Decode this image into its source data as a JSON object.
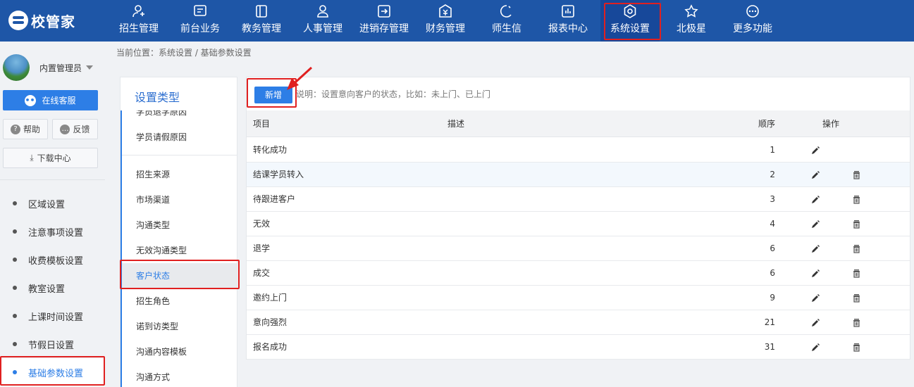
{
  "logo": {
    "text": "校管家"
  },
  "nav": [
    {
      "label": "招生管理",
      "icon": "user-plus-icon"
    },
    {
      "label": "前台业务",
      "icon": "monitor-icon"
    },
    {
      "label": "教务管理",
      "icon": "book-icon"
    },
    {
      "label": "人事管理",
      "icon": "person-icon"
    },
    {
      "label": "进销存管理",
      "icon": "inventory-icon"
    },
    {
      "label": "财务管理",
      "icon": "finance-icon"
    },
    {
      "label": "师生信",
      "icon": "chat-icon"
    },
    {
      "label": "报表中心",
      "icon": "report-icon"
    },
    {
      "label": "系统设置",
      "icon": "settings-icon"
    },
    {
      "label": "北极星",
      "icon": "star-icon"
    },
    {
      "label": "更多功能",
      "icon": "more-icon"
    }
  ],
  "user": {
    "name": "内置管理员"
  },
  "sidebar": {
    "service_label": "在线客服",
    "help_label": "帮助",
    "feedback_label": "反馈",
    "download_label": "下载中心",
    "items": [
      {
        "label": "区域设置"
      },
      {
        "label": "注意事项设置"
      },
      {
        "label": "收费模板设置"
      },
      {
        "label": "教室设置"
      },
      {
        "label": "上课时间设置"
      },
      {
        "label": "节假日设置"
      },
      {
        "label": "基础参数设置"
      }
    ]
  },
  "breadcrumb": "当前位置：系统设置 / 基础参数设置",
  "type_panel": {
    "title": "设置类型",
    "items": [
      {
        "label": "学员退学原因"
      },
      {
        "label": "学员请假原因"
      },
      {
        "label": "招生来源"
      },
      {
        "label": "市场渠道"
      },
      {
        "label": "沟通类型"
      },
      {
        "label": "无效沟通类型"
      },
      {
        "label": "客户状态"
      },
      {
        "label": "招生角色"
      },
      {
        "label": "诺到访类型"
      },
      {
        "label": "沟通内容模板"
      },
      {
        "label": "沟通方式"
      }
    ]
  },
  "main": {
    "add_label": "新增",
    "note": "说明：设置意向客户的状态，比如：未上门、已上门",
    "columns": {
      "item": "项目",
      "desc": "描述",
      "order": "顺序",
      "action": "操作"
    },
    "rows": [
      {
        "item": "转化成功",
        "desc": "",
        "order": "1"
      },
      {
        "item": "结课学员转入",
        "desc": "",
        "order": "2"
      },
      {
        "item": "待跟进客户",
        "desc": "",
        "order": "3"
      },
      {
        "item": "无效",
        "desc": "",
        "order": "4"
      },
      {
        "item": "退学",
        "desc": "",
        "order": "6"
      },
      {
        "item": "成交",
        "desc": "",
        "order": "6"
      },
      {
        "item": "邀约上门",
        "desc": "",
        "order": "9"
      },
      {
        "item": "意向强烈",
        "desc": "",
        "order": "21"
      },
      {
        "item": "报名成功",
        "desc": "",
        "order": "31"
      }
    ]
  },
  "colors": {
    "topbar": "#1e56a7",
    "accent": "#2d7ee6",
    "annotation": "#e02020"
  }
}
